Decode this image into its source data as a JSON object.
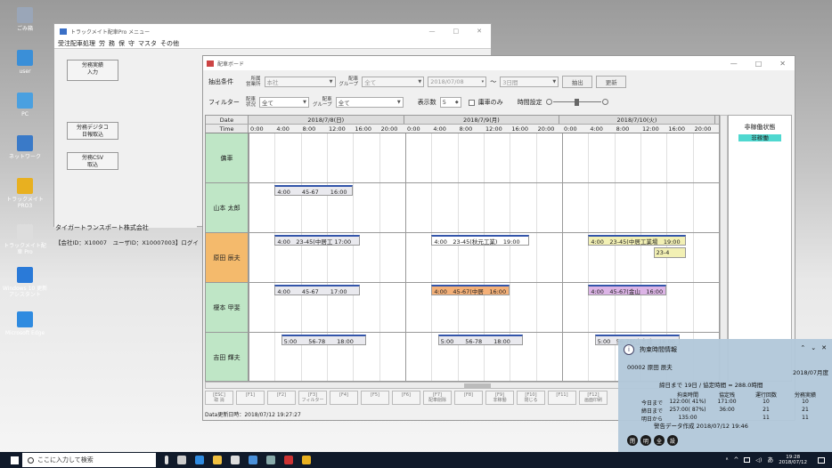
{
  "desktop": {
    "icons": [
      "ごみ箱",
      "user",
      "PC",
      "ネットワーク",
      "トラックメイトPRO3",
      "トラックメイト配車 Pro",
      "Windows 10 更新 アシスタント",
      "Microsoft Edge"
    ]
  },
  "menu_window": {
    "title": "トラックメイト配車Pro メニュー",
    "menu": [
      "受注配車処理",
      "労",
      "務",
      "保",
      "守",
      "マスタ",
      "その他"
    ],
    "buttons": [
      "労務実績\n入力",
      "労務デジタコ\n日報取込",
      "労務CSV\n取込"
    ],
    "company": "タイガートランスポート株式会社",
    "user_line": "【会社ID：X10007　ユーザID：X10007003】ログイ"
  },
  "board": {
    "title": "配車ボード",
    "window_controls": [
      "—",
      "□",
      "✕"
    ],
    "filter1": {
      "label": "抽出条件",
      "office_label": "所属\n営業所",
      "office_value": "本社",
      "group_label": "配車\nグループ",
      "group_value": "全て",
      "date": "2018/07/08",
      "range_sep": "～",
      "days": "3日間",
      "extract": "抽出",
      "update": "更新"
    },
    "filter2": {
      "label": "フィルター",
      "status_label": "配車\n状況",
      "status_value": "全て",
      "group_label": "配車\nグループ",
      "group_value": "全て",
      "count_label": "表示数",
      "count_value": "5",
      "idle_only": "庸車のみ",
      "time_label": "時間設定"
    },
    "grid": {
      "date_caption": "Date",
      "time_caption": "Time",
      "dates": [
        "2018/7/8(日)",
        "2018/7/9(月)",
        "2018/7/10(火)"
      ],
      "hours": [
        "0:00",
        "4:00",
        "8:00",
        "12:00",
        "16:00",
        "20:00"
      ],
      "rows": [
        {
          "name": "傭車",
          "color": "#bfe6c6",
          "bars": []
        },
        {
          "name": "山本 太郎",
          "color": "#bfe6c6",
          "bars": [
            {
              "text": "4:00　　45-67　　16:00",
              "start": 4,
              "end": 16,
              "color": "#e9e9ee"
            }
          ]
        },
        {
          "name": "原田 辰夫",
          "color": "#f4ba6c",
          "bars": [
            {
              "text": "4:00　23-45(中居工 17:00",
              "start": 4,
              "end": 17,
              "color": "#e9e9ee"
            },
            {
              "text": "4:00　23-45(秋元工業)　19:00",
              "start": 28,
              "end": 43,
              "color": "#ffffff"
            },
            {
              "text": "4:00　23-45(中居工業場　19:00",
              "start": 52,
              "end": 67,
              "color": "#f2f0b4"
            }
          ],
          "extra": "23-4"
        },
        {
          "name": "榎本 甲斐",
          "color": "#bfe6c6",
          "bars": [
            {
              "text": "4:00　　45-67　　17:00",
              "start": 4,
              "end": 17,
              "color": "#e9e9ee"
            },
            {
              "text": "4:00　45-67(中居　16:00",
              "start": 28,
              "end": 40,
              "color": "#f4b078"
            },
            {
              "text": "4:00　45-67(金山　16:00",
              "start": 52,
              "end": 64,
              "color": "#dcb4e6"
            }
          ]
        },
        {
          "name": "吉田 輝夫",
          "color": "#bfe6c6",
          "bars": [
            {
              "text": "5:00　　56-78　　18:00",
              "start": 5,
              "end": 18,
              "color": "#e9e9ee"
            },
            {
              "text": "5:00　　56-78　　18:00",
              "start": 29,
              "end": 42,
              "color": "#e9e9ee"
            },
            {
              "text": "5:00　56-78(山本建　18:00",
              "start": 53,
              "end": 66,
              "color": "#e9e9ee"
            }
          ]
        }
      ]
    },
    "status_panel": {
      "title": "非稼働状態",
      "value": "非稼働"
    },
    "fkeys": [
      "[ESC]\n取 消",
      "[F1]",
      "[F2]",
      "[F3]\nフィルター",
      "[F4]",
      "[F5]",
      "[F6]",
      "[F7]\n配車削除",
      "[F8]",
      "[F9]\n非稼働",
      "[F10]\n閉じる",
      "[F11]",
      "[F12]\n画面印刷"
    ],
    "updated": "Data更新日時：2018/07/12 19:27:27"
  },
  "notification": {
    "title": "拘束時間情報",
    "driver": "00002 原田 辰夫",
    "month": "2018/07月度",
    "summary": "締日まで 19日 / 協定時間 = 288.0時間",
    "headers": [
      "拘束時間",
      "協定残",
      "運行回数",
      "労務実績"
    ],
    "rows": [
      {
        "label": "今日まで",
        "vals": [
          "122:00( 41%)",
          "171:00",
          "10",
          "10"
        ]
      },
      {
        "label": "締日まで",
        "vals": [
          "257:00( 87%)",
          "36:00",
          "21",
          "21"
        ]
      },
      {
        "label": "明日から",
        "vals": [
          "135:00",
          "",
          "11",
          "11"
        ]
      }
    ],
    "warning": "警告データ作成 2018/07/12 19:46",
    "circles": [
      "閉",
      "明",
      "全",
      "設"
    ],
    "controls": [
      "⌃",
      "⌄",
      "✕"
    ]
  },
  "taskbar": {
    "search": "ここに入力して検索",
    "time": "19:28",
    "date": "2018/07/12",
    "lang": "あ"
  }
}
